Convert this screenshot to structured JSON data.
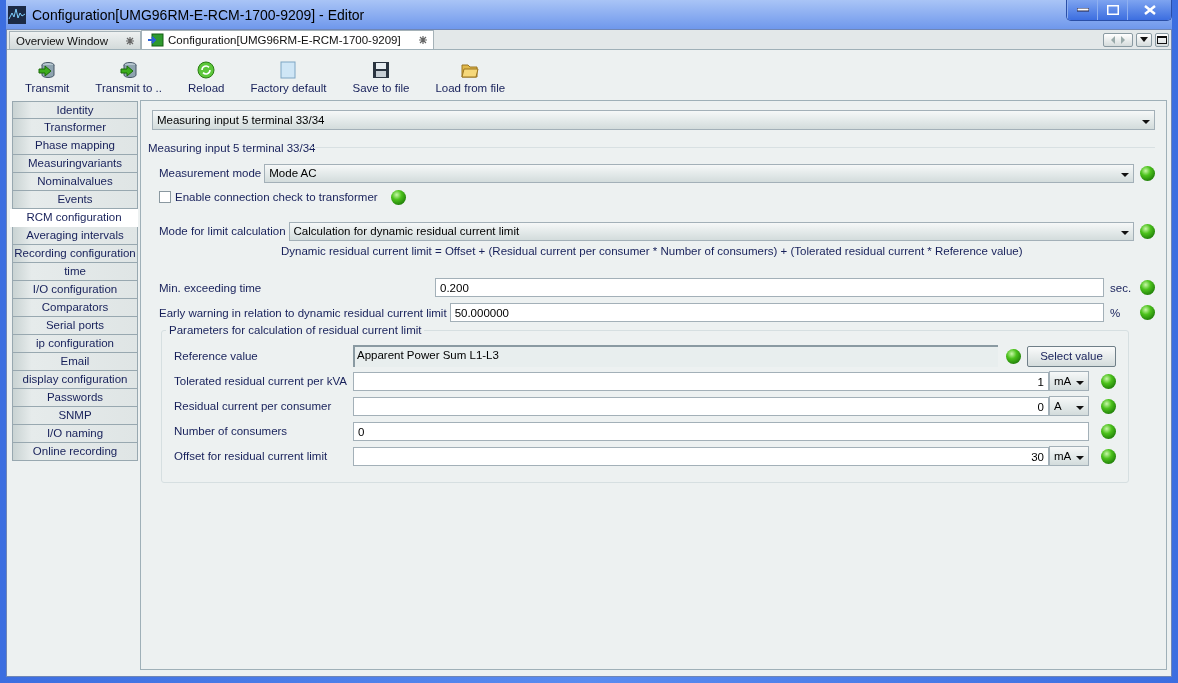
{
  "window": {
    "title": "Configuration[UMG96RM-E-RCM-1700-9209] - Editor"
  },
  "tabs": [
    {
      "label": "Overview Window",
      "selected": false
    },
    {
      "label": "Configuration[UMG96RM-E-RCM-1700-9209]",
      "selected": true
    }
  ],
  "toolbar": [
    {
      "label": "Transmit",
      "kind": "transmit"
    },
    {
      "label": "Transmit to ..",
      "kind": "transmit"
    },
    {
      "label": "Reload",
      "kind": "reload"
    },
    {
      "label": "Factory default",
      "kind": "factory"
    },
    {
      "label": "Save to file",
      "kind": "save"
    },
    {
      "label": "Load from file",
      "kind": "load"
    }
  ],
  "sidebar": {
    "items": [
      {
        "label": "Identity",
        "selected": false
      },
      {
        "label": "Transformer",
        "selected": false
      },
      {
        "label": "Phase mapping",
        "selected": false
      },
      {
        "label": "Measuringvariants",
        "selected": false
      },
      {
        "label": "Nominalvalues",
        "selected": false
      },
      {
        "label": "Events",
        "selected": false
      },
      {
        "label": "RCM configuration",
        "selected": true
      },
      {
        "label": "Averaging intervals",
        "selected": false
      },
      {
        "label": "Recording configuration",
        "selected": false
      },
      {
        "label": "time",
        "selected": false
      },
      {
        "label": "I/O configuration",
        "selected": false
      },
      {
        "label": "Comparators",
        "selected": false
      },
      {
        "label": "Serial ports",
        "selected": false
      },
      {
        "label": "ip configuration",
        "selected": false
      },
      {
        "label": "Email",
        "selected": false
      },
      {
        "label": "display configuration",
        "selected": false
      },
      {
        "label": "Passwords",
        "selected": false
      },
      {
        "label": "SNMP",
        "selected": false
      },
      {
        "label": "I/O naming",
        "selected": false
      },
      {
        "label": "Online recording",
        "selected": false
      }
    ]
  },
  "input_select": {
    "value": "Measuring input 5 terminal 33/34"
  },
  "group": {
    "title": "Measuring input 5 terminal 33/34",
    "measurement_mode": {
      "label": "Measurement mode",
      "value": "Mode AC"
    },
    "connection_check": {
      "label": "Enable connection check to transformer",
      "checked": false
    },
    "limit_mode": {
      "label": "Mode for limit calculation",
      "value": "Calculation for dynamic residual current limit"
    },
    "formula": "Dynamic residual current limit = Offset + (Residual current per consumer * Number of consumers) + (Tolerated residual current * Reference value)",
    "fields": [
      {
        "label": "Min. exceeding time",
        "value": "0.200",
        "unit": "sec."
      },
      {
        "label": "Early warning in relation to dynamic residual current limit",
        "value": "50.000000",
        "unit": "%"
      }
    ],
    "parameters": {
      "title": "Parameters for calculation of residual current limit",
      "rows": [
        {
          "kind": "reference",
          "label": "Reference value",
          "value": "Apparent Power Sum L1-L3",
          "button": "Select value"
        },
        {
          "kind": "unit",
          "label": "Tolerated residual current per kVA",
          "value": "1",
          "unit": "mA"
        },
        {
          "kind": "unit",
          "label": "Residual current per consumer",
          "value": "0",
          "unit": "A"
        },
        {
          "kind": "plain",
          "label": "Number of consumers",
          "value": "0"
        },
        {
          "kind": "unit",
          "label": "Offset for residual current limit",
          "value": "30",
          "unit": "mA"
        }
      ]
    }
  }
}
